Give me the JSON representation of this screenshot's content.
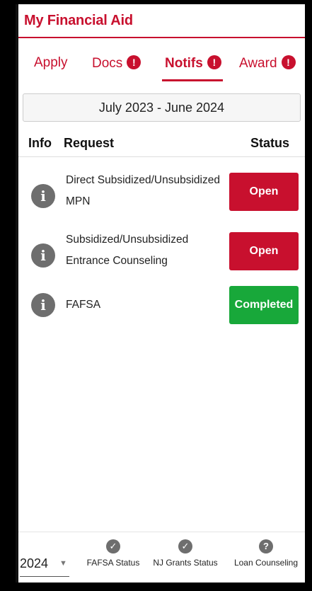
{
  "header": {
    "title": "My Financial Aid"
  },
  "tabs": [
    {
      "label": "Apply",
      "badge": ""
    },
    {
      "label": "Docs",
      "badge": "!"
    },
    {
      "label": "Notifs",
      "badge": "!"
    },
    {
      "label": "Award",
      "badge": "!"
    }
  ],
  "award_year": "July 2023 - June 2024",
  "columns": {
    "info": "Info",
    "request": "Request",
    "status": "Status"
  },
  "requests": [
    {
      "line1": "Direct Subsidized/Unsubsidized",
      "line2": "MPN",
      "status": "Open",
      "status_color": "#c8102e"
    },
    {
      "line1": "Subsidized/Unsubsidized",
      "line2": "Entrance Counseling",
      "status": "Open",
      "status_color": "#c8102e"
    },
    {
      "line1": "FAFSA",
      "line2": "",
      "status": "Completed",
      "status_color": "#18a83a"
    }
  ],
  "footer": {
    "year_select": "2024",
    "nav": [
      {
        "label": "FAFSA Status",
        "icon": "check-circle-icon"
      },
      {
        "label": "NJ Grants Status",
        "icon": "check-circle-icon"
      },
      {
        "label": "Loan Counseling",
        "icon": "question-circle-icon"
      }
    ]
  },
  "colors": {
    "accent": "#c8102e",
    "success": "#18a83a",
    "icon_gray": "#6e6e6e"
  }
}
